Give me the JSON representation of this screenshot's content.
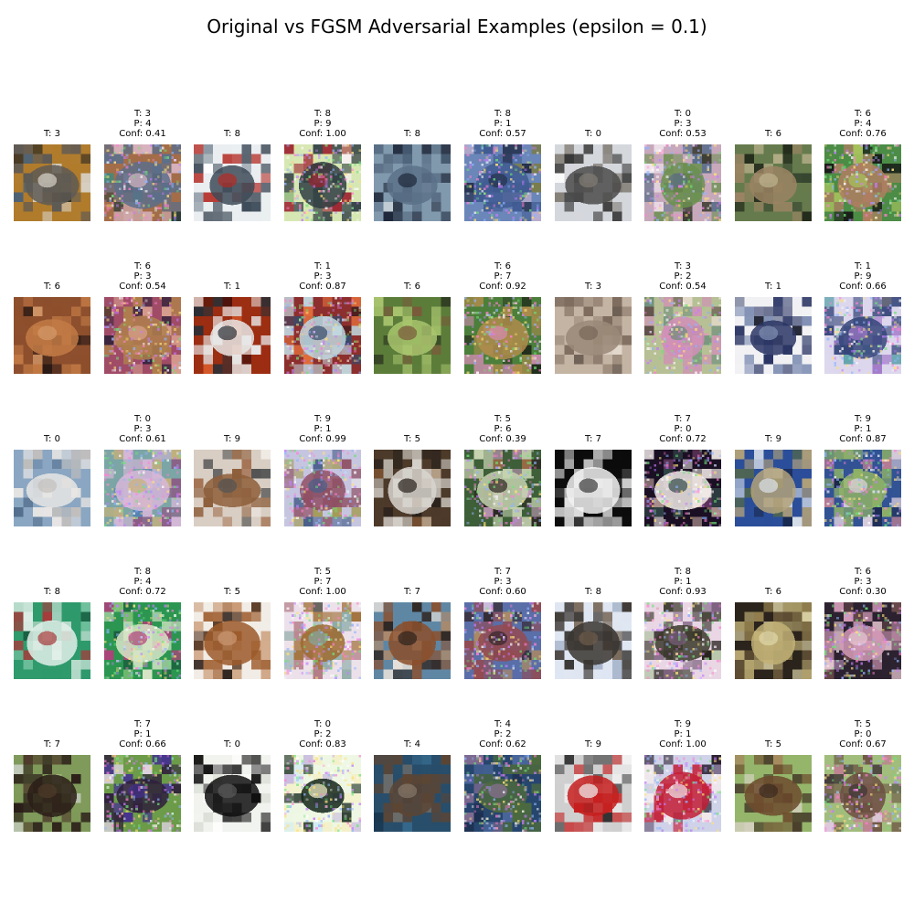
{
  "figure": {
    "title": "Original vs FGSM Adversarial Examples (epsilon = 0.1)"
  },
  "chart_data": {
    "type": "image-grid",
    "title": "Original vs FGSM Adversarial Examples (epsilon = 0.1)",
    "rows": 5,
    "columns": 10,
    "panels": [
      {
        "kind": "original",
        "label": "T: 3",
        "content": "cat",
        "palette": [
          "#b07c2d",
          "#5e5a55",
          "#315a89",
          "#d7d2c8",
          "#2e2a22"
        ]
      },
      {
        "kind": "adversarial",
        "label": "T: 3",
        "prediction": "P: 4",
        "confidence": "Conf: 0.41",
        "content": "cat",
        "palette": [
          "#a36d49",
          "#5c6f8a",
          "#3a8b80",
          "#d9b5c2",
          "#2c3d3a"
        ]
      },
      {
        "kind": "original",
        "label": "T: 8",
        "content": "ship",
        "palette": [
          "#eaeef0",
          "#3d4a57",
          "#ffffff",
          "#b42b24",
          "#8b98a3"
        ]
      },
      {
        "kind": "adversarial",
        "label": "T: 8",
        "prediction": "P: 9",
        "confidence": "Conf: 1.00",
        "content": "ship",
        "palette": [
          "#d7e7b3",
          "#2f3d42",
          "#f6f0ef",
          "#9d2330",
          "#78a86b"
        ]
      },
      {
        "kind": "original",
        "label": "T: 8",
        "content": "ship",
        "palette": [
          "#8199ad",
          "#5b7188",
          "#d8dde2",
          "#20283b",
          "#40536a"
        ]
      },
      {
        "kind": "adversarial",
        "label": "T: 8",
        "prediction": "P: 1",
        "confidence": "Conf: 0.57",
        "content": "ship",
        "palette": [
          "#6b86b8",
          "#405b92",
          "#c5b3cf",
          "#24304c",
          "#7a7c48"
        ]
      },
      {
        "kind": "original",
        "label": "T: 0",
        "content": "airplane",
        "palette": [
          "#d4d7dc",
          "#4b4b4b",
          "#ffffff",
          "#817c74",
          "#343434"
        ]
      },
      {
        "kind": "adversarial",
        "label": "T: 0",
        "prediction": "P: 3",
        "confidence": "Conf: 0.53",
        "content": "airplane",
        "palette": [
          "#c7a8bb",
          "#6a8f4f",
          "#f2e9ef",
          "#5c6e8a",
          "#3a3a2f"
        ]
      },
      {
        "kind": "original",
        "label": "T: 6",
        "content": "frog",
        "palette": [
          "#667b4d",
          "#9b8463",
          "#37462f",
          "#bdb38e",
          "#1e2518"
        ]
      },
      {
        "kind": "adversarial",
        "label": "T: 6",
        "prediction": "P: 4",
        "confidence": "Conf: 0.76",
        "content": "frog",
        "palette": [
          "#4c8c46",
          "#b07e62",
          "#273d25",
          "#a7c35d",
          "#191d18"
        ]
      },
      {
        "kind": "original",
        "label": "T: 6",
        "content": "frog",
        "palette": [
          "#8d4f2d",
          "#c27a45",
          "#4b2a1f",
          "#d49a6a",
          "#2c1a14"
        ]
      },
      {
        "kind": "adversarial",
        "label": "T: 6",
        "prediction": "P: 3",
        "confidence": "Conf: 0.54",
        "content": "frog",
        "palette": [
          "#a04c67",
          "#af804c",
          "#513d2c",
          "#d8a18f",
          "#35243b"
        ]
      },
      {
        "kind": "original",
        "label": "T: 1",
        "content": "automobile",
        "palette": [
          "#9c2e12",
          "#e8e8e8",
          "#4d130a",
          "#2b2f35",
          "#d95b2b"
        ]
      },
      {
        "kind": "adversarial",
        "label": "T: 1",
        "prediction": "P: 3",
        "confidence": "Conf: 0.87",
        "content": "automobile",
        "palette": [
          "#8d2f2e",
          "#c1d7de",
          "#3d1b1c",
          "#364a6c",
          "#e26d3b"
        ]
      },
      {
        "kind": "original",
        "label": "T: 6",
        "content": "frog",
        "palette": [
          "#5c7d3a",
          "#a8c46d",
          "#2c3820",
          "#7b5a3a",
          "#1f2218"
        ]
      },
      {
        "kind": "adversarial",
        "label": "T: 6",
        "prediction": "P: 7",
        "confidence": "Conf: 0.92",
        "content": "frog",
        "palette": [
          "#4c7f3b",
          "#b08c4c",
          "#2b3a23",
          "#d58cb5",
          "#1c2418"
        ]
      },
      {
        "kind": "original",
        "label": "T: 3",
        "content": "cat",
        "palette": [
          "#c4b4a3",
          "#9a8878",
          "#e2d8cd",
          "#786658",
          "#4e4038"
        ]
      },
      {
        "kind": "adversarial",
        "label": "T: 3",
        "prediction": "P: 2",
        "confidence": "Conf: 0.54",
        "content": "cat",
        "palette": [
          "#b7c095",
          "#d28eb8",
          "#e5dacb",
          "#6c8c7a",
          "#5d4c48"
        ]
      },
      {
        "kind": "original",
        "label": "T: 1",
        "content": "automobile",
        "palette": [
          "#f1f1f4",
          "#2b3664",
          "#1b1f2d",
          "#8190b4",
          "#4c5679"
        ]
      },
      {
        "kind": "adversarial",
        "label": "T: 1",
        "prediction": "P: 9",
        "confidence": "Conf: 0.66",
        "content": "automobile",
        "palette": [
          "#dcd7ec",
          "#35457a",
          "#1a2033",
          "#a47ac9",
          "#58a0a8"
        ]
      },
      {
        "kind": "original",
        "label": "T: 0",
        "content": "airplane",
        "palette": [
          "#8aa6c2",
          "#e8e6e4",
          "#6a88a8",
          "#c4c0bc",
          "#54708e"
        ]
      },
      {
        "kind": "adversarial",
        "label": "T: 0",
        "prediction": "P: 3",
        "confidence": "Conf: 0.61",
        "content": "airplane",
        "palette": [
          "#7ca5a6",
          "#d8b7d9",
          "#5582b4",
          "#c7b27a",
          "#8c5c86"
        ]
      },
      {
        "kind": "original",
        "label": "T: 9",
        "content": "truck",
        "palette": [
          "#d9cec3",
          "#8d5e3a",
          "#f1eee8",
          "#545454",
          "#a57555"
        ]
      },
      {
        "kind": "adversarial",
        "label": "T: 9",
        "prediction": "P: 1",
        "confidence": "Conf: 0.99",
        "content": "truck",
        "palette": [
          "#c6c5e0",
          "#8f4f63",
          "#ebe7e8",
          "#495f8b",
          "#a39b54"
        ]
      },
      {
        "kind": "original",
        "label": "T: 5",
        "content": "dog",
        "palette": [
          "#4d3a2a",
          "#d8d5cf",
          "#8a5a33",
          "#2a221c",
          "#b9a38a"
        ]
      },
      {
        "kind": "adversarial",
        "label": "T: 5",
        "prediction": "P: 6",
        "confidence": "Conf: 0.39",
        "content": "dog",
        "palette": [
          "#3e5f38",
          "#c6d2b0",
          "#9d6b45",
          "#2c2520",
          "#c79ac0"
        ]
      },
      {
        "kind": "original",
        "label": "T: 7",
        "content": "horse",
        "palette": [
          "#0c0c0c",
          "#f2f2f2",
          "#7a7a7a",
          "#3a3a3a",
          "#c8c8c8"
        ]
      },
      {
        "kind": "adversarial",
        "label": "T: 7",
        "prediction": "P: 0",
        "confidence": "Conf: 0.72",
        "content": "horse",
        "palette": [
          "#1b1024",
          "#f3ece9",
          "#6f3d66",
          "#334a4a",
          "#cfb0a6"
        ]
      },
      {
        "kind": "original",
        "label": "T: 9",
        "content": "truck",
        "palette": [
          "#2b4e9a",
          "#b3a279",
          "#18274a",
          "#dbe2ea",
          "#5c6d3a"
        ]
      },
      {
        "kind": "adversarial",
        "label": "T: 9",
        "prediction": "P: 1",
        "confidence": "Conf: 0.87",
        "content": "truck",
        "palette": [
          "#325394",
          "#8fb366",
          "#1b274a",
          "#e0d2df",
          "#c27f92"
        ]
      },
      {
        "kind": "original",
        "label": "T: 8",
        "content": "ship",
        "palette": [
          "#2f9a6c",
          "#e2efe9",
          "#1a5c42",
          "#a63b3b",
          "#75c2a0"
        ]
      },
      {
        "kind": "adversarial",
        "label": "T: 8",
        "prediction": "P: 4",
        "confidence": "Conf: 0.72",
        "content": "ship",
        "palette": [
          "#2c9651",
          "#d9e6c8",
          "#195a3d",
          "#b0407a",
          "#85c276"
        ]
      },
      {
        "kind": "original",
        "label": "T: 5",
        "content": "dog",
        "palette": [
          "#f1ece6",
          "#9c5a2a",
          "#2b1e19",
          "#c99873",
          "#5a3a25"
        ]
      },
      {
        "kind": "adversarial",
        "label": "T: 5",
        "prediction": "P: 7",
        "confidence": "Conf: 1.00",
        "content": "dog",
        "palette": [
          "#ece1ea",
          "#9c6a2f",
          "#2b2b1e",
          "#86a7a1",
          "#b47d88"
        ]
      },
      {
        "kind": "original",
        "label": "T: 7",
        "content": "horse",
        "palette": [
          "#5f87a4",
          "#8b4f2c",
          "#e7e1da",
          "#2e221c",
          "#b48a67"
        ]
      },
      {
        "kind": "adversarial",
        "label": "T: 7",
        "prediction": "P: 3",
        "confidence": "Conf: 0.60",
        "content": "horse",
        "palette": [
          "#5a6ea8",
          "#944a50",
          "#e0cbe5",
          "#33262b",
          "#b88e5a"
        ]
      },
      {
        "kind": "original",
        "label": "T: 8",
        "content": "ship",
        "palette": [
          "#dfe6f2",
          "#3a3530",
          "#a7b5cb",
          "#6e5d4b",
          "#26221e"
        ]
      },
      {
        "kind": "adversarial",
        "label": "T: 8",
        "prediction": "P: 1",
        "confidence": "Conf: 0.93",
        "content": "ship",
        "palette": [
          "#e9d6e4",
          "#3b3a2c",
          "#aac39b",
          "#7a5f7d",
          "#2a2420"
        ]
      },
      {
        "kind": "original",
        "label": "T: 6",
        "content": "frog",
        "palette": [
          "#2b241c",
          "#c2b177",
          "#6d5a3b",
          "#e0d7a9",
          "#93804f"
        ]
      },
      {
        "kind": "adversarial",
        "label": "T: 6",
        "prediction": "P: 3",
        "confidence": "Conf: 0.30",
        "content": "frog",
        "palette": [
          "#2c2230",
          "#d29ab6",
          "#6a4a4c",
          "#e8c9d2",
          "#8e6d92"
        ]
      },
      {
        "kind": "original",
        "label": "T: 7",
        "content": "horse",
        "palette": [
          "#7f9a5a",
          "#2a1d18",
          "#dcdde0",
          "#4e3a2a",
          "#a7bb83"
        ]
      },
      {
        "kind": "adversarial",
        "label": "T: 7",
        "prediction": "P: 1",
        "confidence": "Conf: 0.66",
        "content": "horse",
        "palette": [
          "#6c9b49",
          "#2e1f3b",
          "#e2d6e8",
          "#45328e",
          "#9bc36e"
        ]
      },
      {
        "kind": "original",
        "label": "T: 0",
        "content": "airplane",
        "palette": [
          "#f1f3ef",
          "#0f0f0f",
          "#d9ded6",
          "#5a5a5a",
          "#ffffff"
        ]
      },
      {
        "kind": "adversarial",
        "label": "T: 0",
        "prediction": "P: 2",
        "confidence": "Conf: 0.83",
        "content": "airplane",
        "palette": [
          "#eef7e3",
          "#13261a",
          "#d0eaf4",
          "#f4f0c6",
          "#c4b4de"
        ]
      },
      {
        "kind": "original",
        "label": "T: 4",
        "content": "deer",
        "palette": [
          "#284e6b",
          "#5c4534",
          "#173349",
          "#84776a",
          "#35688a"
        ]
      },
      {
        "kind": "adversarial",
        "label": "T: 4",
        "prediction": "P: 2",
        "confidence": "Conf: 0.62",
        "content": "deer",
        "palette": [
          "#27466e",
          "#4c6a3e",
          "#1d2f4f",
          "#8a6f95",
          "#4d6aa0"
        ]
      },
      {
        "kind": "original",
        "label": "T: 9",
        "content": "truck",
        "palette": [
          "#cfcfcf",
          "#c51f1f",
          "#6b6b6b",
          "#f1f1f1",
          "#2a2a2a"
        ]
      },
      {
        "kind": "adversarial",
        "label": "T: 9",
        "prediction": "P: 1",
        "confidence": "Conf: 1.00",
        "content": "truck",
        "palette": [
          "#cfd2e8",
          "#c31d35",
          "#6c5d7c",
          "#f1e9ec",
          "#2c2230"
        ]
      },
      {
        "kind": "original",
        "label": "T: 5",
        "content": "dog",
        "palette": [
          "#95b56b",
          "#6d4b2e",
          "#d4d0c0",
          "#3b2a20",
          "#a58a5f"
        ]
      },
      {
        "kind": "adversarial",
        "label": "T: 5",
        "prediction": "P: 0",
        "confidence": "Conf: 0.67",
        "content": "dog",
        "palette": [
          "#a1bd7c",
          "#6c5042",
          "#e0c8e1",
          "#3f3437",
          "#c07f93"
        ]
      }
    ]
  }
}
